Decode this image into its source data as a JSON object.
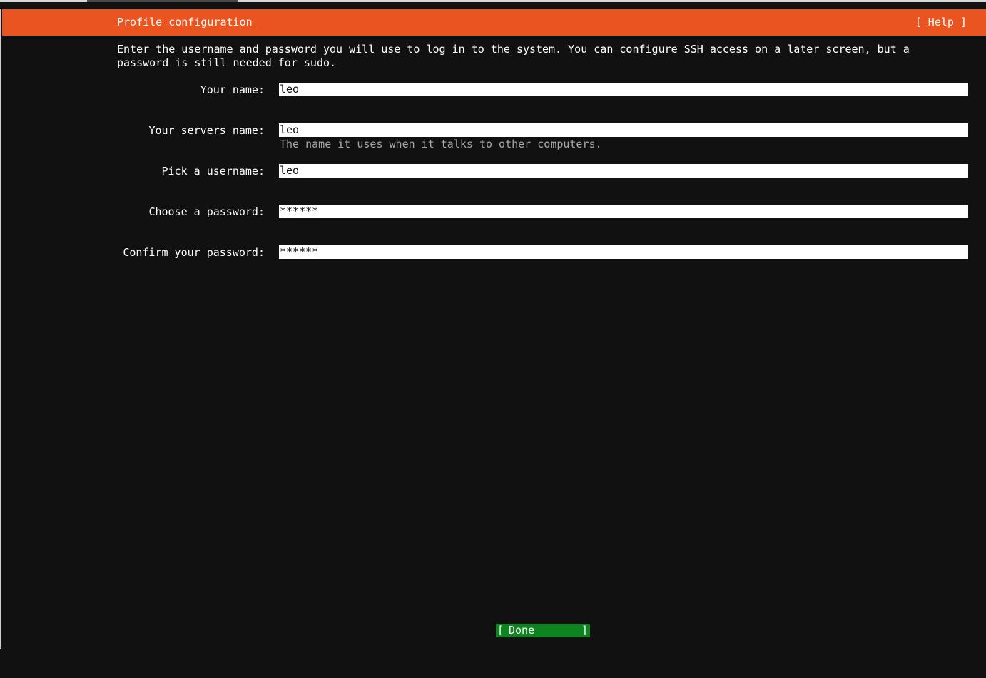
{
  "header": {
    "title": "Profile configuration",
    "help_label": "[ Help ]"
  },
  "intro": "Enter the username and password you will use to log in to the system. You can configure SSH access on a later screen, but a\npassword is still needed for sudo.",
  "fields": {
    "name": {
      "label": "Your name:",
      "value": "leo"
    },
    "server": {
      "label": "Your servers name:",
      "value": "leo",
      "hint": "The name it uses when it talks to other computers."
    },
    "username": {
      "label": "Pick a username:",
      "value": "leo"
    },
    "password": {
      "label": "Choose a password:",
      "value": "******"
    },
    "confirm": {
      "label": "Confirm your password:",
      "value": "******"
    }
  },
  "done": {
    "open": "[",
    "first_letter": "D",
    "rest": "one",
    "close": "]"
  },
  "colors": {
    "header_bg": "#e95420",
    "background": "#111111",
    "button_bg": "#0e8420"
  }
}
